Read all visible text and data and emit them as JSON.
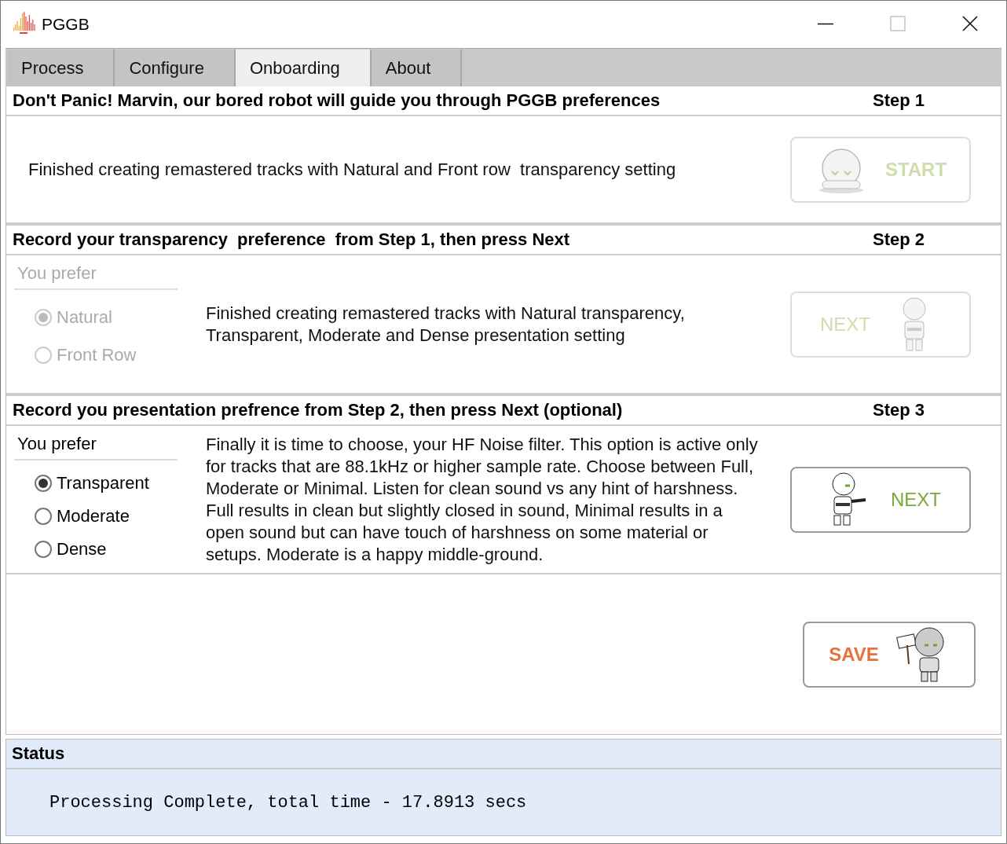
{
  "window": {
    "title": "PGGB"
  },
  "tabs": [
    {
      "label": "Process",
      "selected": false
    },
    {
      "label": "Configure",
      "selected": false
    },
    {
      "label": "Onboarding",
      "selected": true
    },
    {
      "label": "About",
      "selected": false
    }
  ],
  "steps": [
    {
      "title": "Don't Panic! Marvin, our bored robot will guide you through PGGB preferences",
      "step": "Step 1",
      "description": "Finished creating remastered tracks with Natural and Front row  transparency setting",
      "button": {
        "label": "START",
        "kind": "sitting",
        "disabled": true
      }
    },
    {
      "title": "Record your transparency  preference  from Step 1, then press Next",
      "step": "Step 2",
      "preference": {
        "label": "You prefer",
        "disabled": true,
        "options": [
          {
            "label": "Natural",
            "selected": true
          },
          {
            "label": "Front Row",
            "selected": false
          }
        ]
      },
      "description": "Finished creating remastered tracks with Natural transparency, Transparent, Moderate and Dense presentation setting",
      "button": {
        "label": "NEXT",
        "kind": "standing",
        "disabled": true
      }
    },
    {
      "title": "Record you presentation prefrence from Step 2, then press Next (optional)",
      "step": "Step 3",
      "preference": {
        "label": "You prefer",
        "disabled": false,
        "options": [
          {
            "label": "Transparent",
            "selected": true
          },
          {
            "label": "Moderate",
            "selected": false
          },
          {
            "label": "Dense",
            "selected": false
          }
        ]
      },
      "description": "Finally it is time to choose, your HF Noise filter. This option is active only for tracks that are 88.1kHz or higher sample rate. Choose between Full, Moderate or Minimal. Listen for clean sound vs any hint of harshness. Full results in clean but slightly closed in sound, Minimal results in a open sound but can have touch of harshness on some material or setups. Moderate is a happy middle-ground.",
      "button": {
        "label": "NEXT",
        "kind": "pointing",
        "disabled": false
      }
    }
  ],
  "save": {
    "label": "SAVE",
    "kind": "sign"
  },
  "status": {
    "title": "Status",
    "message": "Processing Complete, total time - 17.8913 secs"
  }
}
